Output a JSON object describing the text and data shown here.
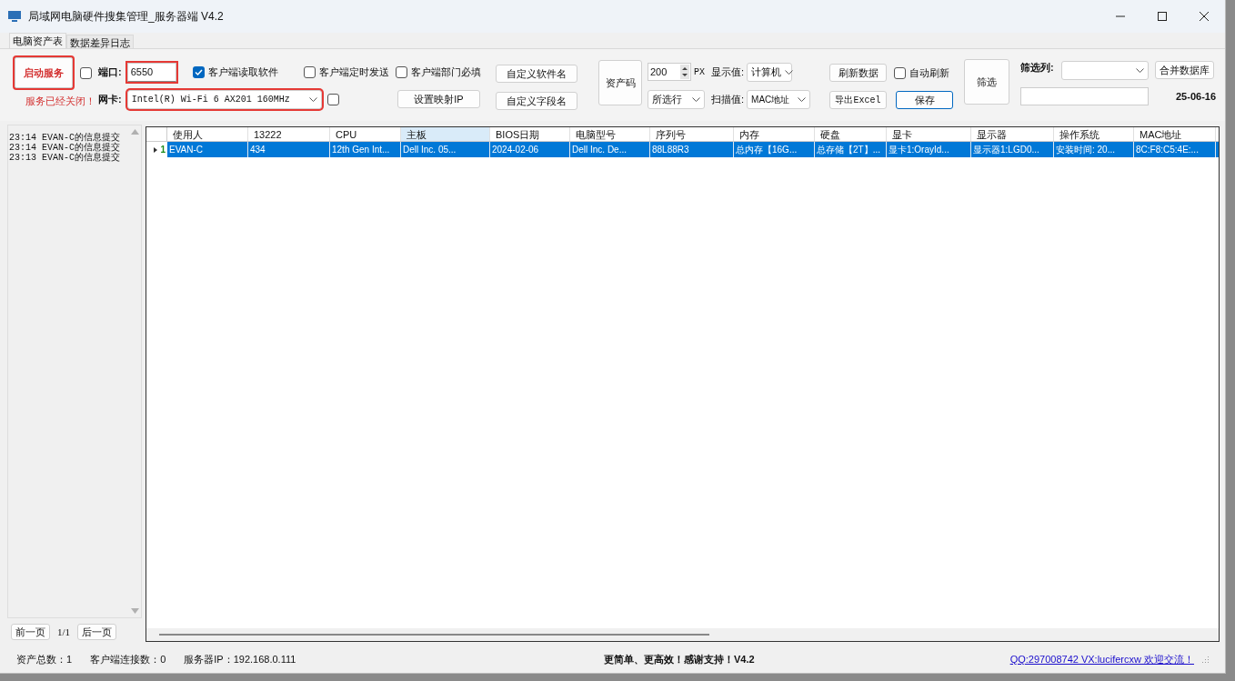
{
  "window": {
    "title": "局域网电脑硬件搜集管理_服务器端 V4.2"
  },
  "tabs": [
    {
      "label": "电脑资产表",
      "selected": true
    },
    {
      "label": "数据差异日志",
      "selected": false
    }
  ],
  "toolbar": {
    "start_button": {
      "label": "启动服务",
      "annotated": true
    },
    "service_checkbox": {
      "checked": false
    },
    "service_status": "服务已经关闭！",
    "port": {
      "label": "端口:",
      "value": "6550",
      "annotated": true
    },
    "nic": {
      "label": "网卡:",
      "value": "Intel(R) Wi-Fi 6 AX201 160MHz",
      "annotated": true
    },
    "nic_checkbox": {
      "checked": false
    },
    "options": [
      {
        "label": "客户端读取软件",
        "checked": true
      },
      {
        "label": "客户端定时发送",
        "checked": false
      },
      {
        "label": "客户端部门必填",
        "checked": false
      }
    ],
    "map_ip_button": "设置映射IP",
    "custom_buttons": [
      "自定义软件名",
      "自定义字段名"
    ],
    "asset_code_button": "资产码",
    "size": {
      "value": "200",
      "unit": "PX"
    },
    "row_select": "所选行",
    "display": {
      "label": "显示值:",
      "value": "计算机"
    },
    "scan": {
      "label": "扫描值:",
      "value": "MAC地址"
    },
    "refresh_button": "刷新数据",
    "auto_refresh": {
      "label": "自动刷新",
      "checked": false
    },
    "export_button": "导出Excel",
    "save_button": "保存",
    "filter_button": "筛选",
    "filter_column": {
      "label": "筛选列:"
    },
    "merge_button": "合并数据库",
    "date": "25-06-16"
  },
  "log": [
    "23:14 EVAN-C的信息提交",
    "23:14 EVAN-C的信息提交",
    "23:13 EVAN-C的信息提交"
  ],
  "pager": {
    "prev": "前一页",
    "page": "1/1",
    "next": "后一页"
  },
  "table": {
    "columns": [
      {
        "label": "使用人",
        "highlighted": false
      },
      {
        "label": "13222",
        "highlighted": false
      },
      {
        "label": "CPU",
        "highlighted": false
      },
      {
        "label": "主板",
        "highlighted": true
      },
      {
        "label": "BIOS日期",
        "highlighted": false
      },
      {
        "label": "电脑型号",
        "highlighted": false
      },
      {
        "label": "序列号",
        "highlighted": false
      },
      {
        "label": "内存",
        "highlighted": false
      },
      {
        "label": "硬盘",
        "highlighted": false
      },
      {
        "label": "显卡",
        "highlighted": false
      },
      {
        "label": "显示器",
        "highlighted": false
      },
      {
        "label": "操作系统",
        "highlighted": false
      },
      {
        "label": "MAC地址",
        "highlighted": false
      }
    ],
    "rows": [
      {
        "number": "1",
        "selected": true,
        "cells": [
          "EVAN-C",
          "434",
          "12th Gen Int...",
          "Dell Inc. 05...",
          "2024-02-06",
          "Dell Inc. De...",
          "88L88R3",
          "总内存【16G...",
          "总存储【2T】...",
          "显卡1:OrayId...",
          "显示器1:LGD0...",
          "安装时间: 20...",
          "8C:F8:C5:4E:..."
        ]
      }
    ]
  },
  "status_bar": {
    "items": [
      "资产总数：1",
      "客户端连接数：0",
      "服务器IP：192.168.0.111"
    ],
    "message": "更简单、更高效！感谢支持！V4.2",
    "link": "QQ:297008742  VX:lucifercxw 欢迎交流！"
  }
}
